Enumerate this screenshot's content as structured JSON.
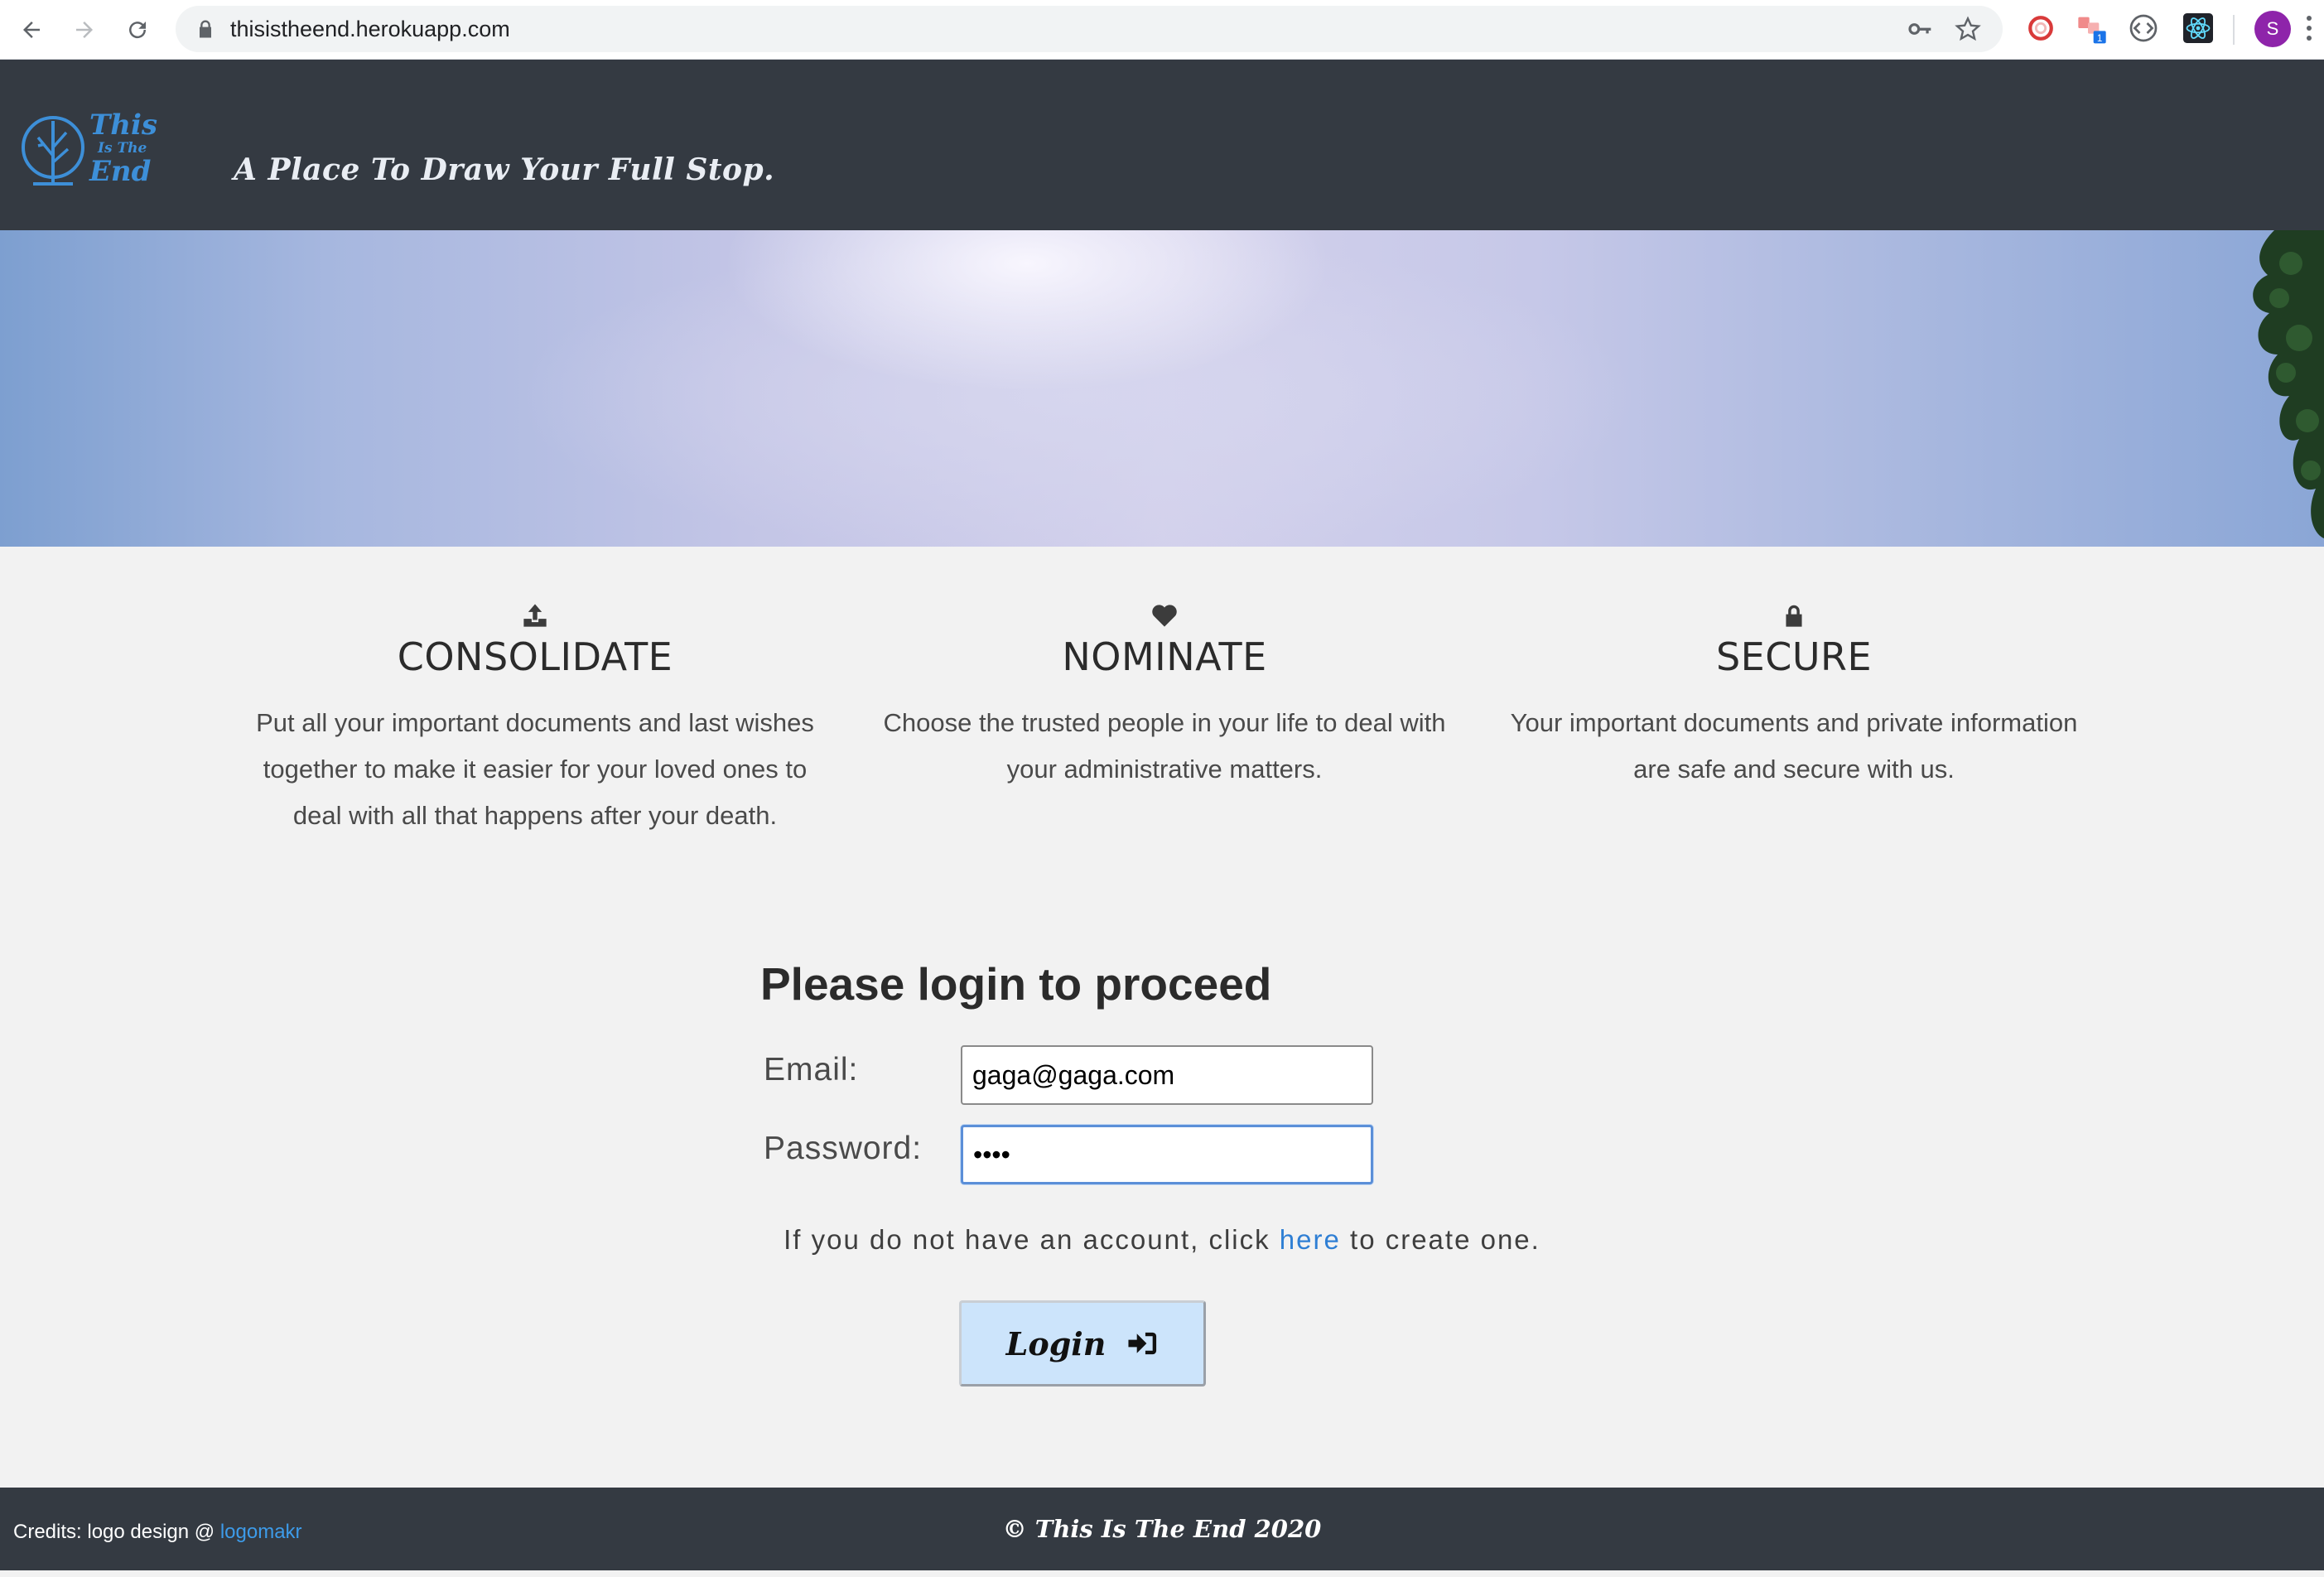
{
  "browser": {
    "url": "thisistheend.herokuapp.com",
    "avatar_letter": "S",
    "extension_badge": "1"
  },
  "header": {
    "logo_text": [
      "This",
      "Is The",
      "End"
    ],
    "tagline": "A Place To Draw Your Full Stop."
  },
  "features": [
    {
      "icon": "upload-icon",
      "title": "CONSOLIDATE",
      "text": "Put all your important documents and last wishes together to make it easier for your loved ones to deal with all that happens after your death."
    },
    {
      "icon": "heart-icon",
      "title": "NOMINATE",
      "text": "Choose the trusted people in your life to deal with your administrative matters."
    },
    {
      "icon": "lock-icon",
      "title": "SECURE",
      "text": "Your important documents and private information are safe and secure with us."
    }
  ],
  "login": {
    "title": "Please login to proceed",
    "email_label": "Email:",
    "email_value": "gaga@gaga.com",
    "password_label": "Password:",
    "password_value": "gaga",
    "signup_prefix": "If you do not have an account, click ",
    "signup_link": "here",
    "signup_suffix": " to create one.",
    "button_label": "Login"
  },
  "footer": {
    "credits_prefix": "Credits: logo design @ ",
    "credits_link": "logomakr",
    "copyright": "© This Is The End 2020"
  },
  "colors": {
    "header_bg": "#343a42",
    "page_bg": "#f2f2f2",
    "logo_blue": "#3d8fd8",
    "link_blue": "#2f7fd4",
    "button_bg": "#cce4fb"
  }
}
